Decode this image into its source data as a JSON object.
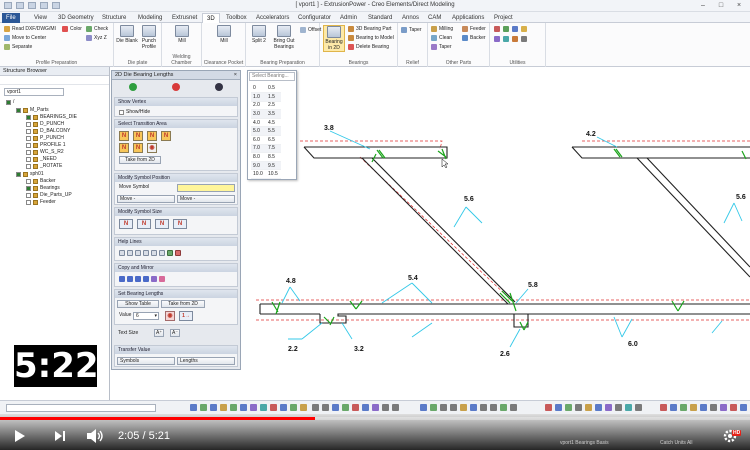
{
  "window": {
    "title": "[ vport1 ] - ExtrusionPower - Creo Elements/Direct Modeling"
  },
  "menu": {
    "tabs": [
      "File",
      "View",
      "3D Geometry",
      "Structure",
      "Modeling",
      "Extrusnet",
      "3D",
      "Toolbox",
      "Accelerators",
      "Configurator",
      "Admin",
      "Standard",
      "Annos",
      "CAM",
      "Applications",
      "Project"
    ],
    "active": "3D"
  },
  "ribbon": {
    "groups": [
      "Profile Preparation",
      "Die plate",
      "Welding Chamber",
      "Clearance Pocket",
      "Bearing Preparation",
      "Bearings",
      "Relief",
      "Other Parts",
      "Utilities"
    ],
    "items": {
      "read_dxf": "Read DXF/DWG/MI",
      "color": "Color",
      "check": "Check",
      "move_to_center": "Move to Center",
      "xyz_z": "Xyz Z",
      "separate": "Separate",
      "die_blank": "Die Blank",
      "punch_profile": "Punch Profile",
      "mill_1": "Mill",
      "mill_2": "Mill",
      "split": "Split 2",
      "bring_out_bearings": "Bring Out Bearings",
      "offset": "Offset",
      "bearing_in_2d": "Bearing in 2D",
      "bearing_3d_part": "3D Bearing Part",
      "bearing_to_model": "Bearing to Model",
      "delete_bearing": "Delete Bearing",
      "taper": "Taper",
      "milling": "Milling",
      "clean": "Clean",
      "taper2": "Taper",
      "feeder": "Feeder",
      "backer": "Backer"
    }
  },
  "structure_browser": {
    "title": "Structure Browser",
    "root": "vport1",
    "items": [
      {
        "label": "/",
        "level": 0
      },
      {
        "label": "M_Parts",
        "level": 1
      },
      {
        "label": "BEARINGS_DIE",
        "level": 2
      },
      {
        "label": "D_PUNCH",
        "level": 2
      },
      {
        "label": "D_BALCONY",
        "level": 2
      },
      {
        "label": "P_PUNCH",
        "level": 2
      },
      {
        "label": "PROFILE 1",
        "level": 2
      },
      {
        "label": "WC_S_R2",
        "level": 2
      },
      {
        "label": "_NEED",
        "level": 2
      },
      {
        "label": "_ROTATE",
        "level": 2
      },
      {
        "label": "sph01",
        "level": 1
      },
      {
        "label": "Backer",
        "level": 2
      },
      {
        "label": "Bearings",
        "level": 2
      },
      {
        "label": "Die_Parts_UP",
        "level": 2
      },
      {
        "label": "Feeder",
        "level": 2
      }
    ]
  },
  "die_panel": {
    "title": "2D Die Bearing Lengths",
    "show_vertex": {
      "header": "Show Vertex",
      "label": "Show/Hide"
    },
    "transition": {
      "header": "Select Transition Area",
      "tiles": [
        "N",
        "N",
        "N",
        "N",
        "N",
        "N"
      ],
      "take_from_2d": "Take from 2D"
    },
    "symbol_position": {
      "header": "Modify Symbol Position",
      "move_symbol": "Move Symbol",
      "move_left": "Move -",
      "move_right": "Move -"
    },
    "symbol_size": {
      "header": "Modify Symbol Size"
    },
    "help_lines": {
      "header": "Help Lines"
    },
    "copy_mirror": {
      "header": "Copy and Mirror"
    },
    "bearing_lengths": {
      "header": "Set Bearing Lengths",
      "show_table": "Show Table",
      "take_from_2d": "Take from 2D",
      "value_label": "Value",
      "value": "6"
    },
    "text_size": {
      "label": "Text Size"
    },
    "transfer": {
      "header": "Transfer Value",
      "symbols": "Symbols",
      "lengths": "Lengths"
    }
  },
  "select_bearing": {
    "placeholder": "Select Bearing...",
    "rows": [
      [
        "0",
        "0.5"
      ],
      [
        "1.0",
        "1.5"
      ],
      [
        "2.0",
        "2.5"
      ],
      [
        "3.0",
        "3.5"
      ],
      [
        "4.0",
        "4.5"
      ],
      [
        "5.0",
        "5.5"
      ],
      [
        "6.0",
        "6.5"
      ],
      [
        "7.0",
        "7.5"
      ],
      [
        "8.0",
        "8.5"
      ],
      [
        "9.0",
        "9.5"
      ],
      [
        "10.0",
        "10.5"
      ]
    ]
  },
  "drawing": {
    "dims": [
      "3.8",
      "4.2",
      "5.6",
      "5.6",
      "4.8",
      "5.4",
      "5.8",
      "2.2",
      "3.2",
      "2.6",
      "6.0"
    ]
  },
  "status": {
    "text": "vport1 Bearings Basis",
    "right": "Catch  Units  All"
  },
  "video": {
    "overlay_time": "5:22",
    "current": "2:05",
    "total": "5:21",
    "time_label": "2:05 / 5:21",
    "progress": 0.42,
    "hd": "HD"
  }
}
